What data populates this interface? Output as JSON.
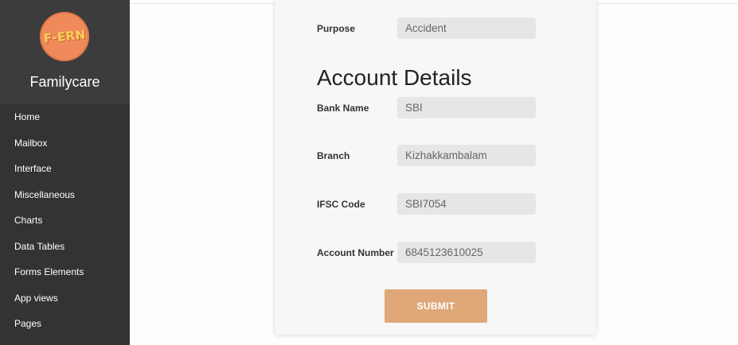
{
  "app": {
    "logo_text": "F-ERN",
    "brand_name": "Familycare"
  },
  "sidebar": {
    "items": [
      {
        "label": "Home"
      },
      {
        "label": "Mailbox"
      },
      {
        "label": "Interface"
      },
      {
        "label": "Miscellaneous"
      },
      {
        "label": "Charts"
      },
      {
        "label": "Data Tables"
      },
      {
        "label": "Forms Elements"
      },
      {
        "label": "App views"
      },
      {
        "label": "Pages"
      }
    ]
  },
  "form": {
    "purpose": {
      "label": "Purpose",
      "value": "Accident"
    },
    "section_title": "Account Details",
    "bank_name": {
      "label": "Bank Name",
      "value": "SBI"
    },
    "branch": {
      "label": "Branch",
      "value": "Kizhakkambalam"
    },
    "ifsc": {
      "label": "IFSC Code",
      "value": "SBI7054"
    },
    "account_number": {
      "label": "Account Number",
      "value": "6845123610025"
    },
    "submit_label": "SUBMIT"
  },
  "colors": {
    "sidebar_bg": "#333333",
    "brand_bg": "#3c3c3c",
    "logo": "#f08a5a",
    "submit": "#e0a879",
    "field_bg": "#e6e6e6"
  }
}
